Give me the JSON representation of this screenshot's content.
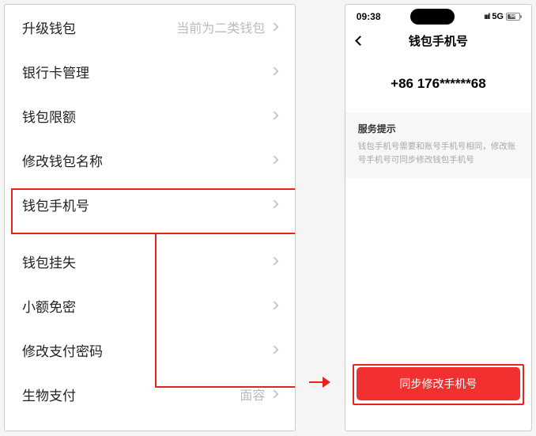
{
  "left_screen": {
    "items": [
      {
        "label": "升级钱包",
        "subvalue": "当前为二类钱包"
      },
      {
        "label": "银行卡管理",
        "subvalue": ""
      },
      {
        "label": "钱包限额",
        "subvalue": ""
      },
      {
        "label": "修改钱包名称",
        "subvalue": ""
      },
      {
        "label": "钱包手机号",
        "subvalue": ""
      },
      {
        "label": "钱包挂失",
        "subvalue": ""
      },
      {
        "label": "小额免密",
        "subvalue": ""
      },
      {
        "label": "修改支付密码",
        "subvalue": ""
      },
      {
        "label": "生物支付",
        "subvalue": "面容"
      }
    ]
  },
  "right_screen": {
    "status": {
      "time": "09:38",
      "network": "5G",
      "battery_text": "68"
    },
    "nav_title": "钱包手机号",
    "phone_number": "+86 176******68",
    "tip_title": "服务提示",
    "tip_body": "钱包手机号需要和账号手机号相同，修改账号手机号可同步修改钱包手机号",
    "action_button": "同步修改手机号"
  }
}
